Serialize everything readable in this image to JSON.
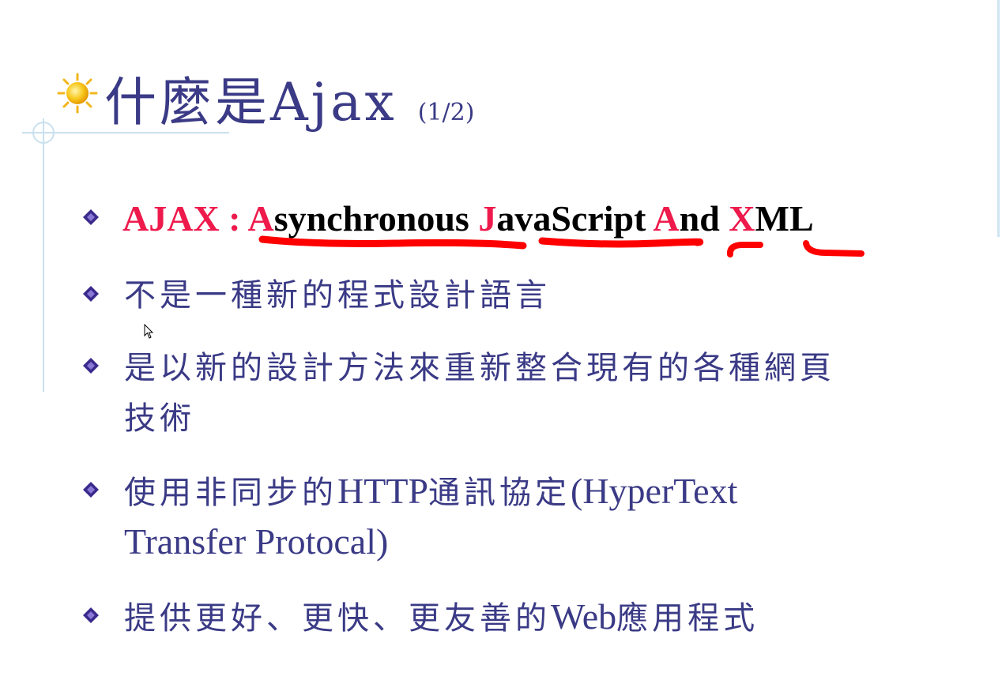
{
  "title": {
    "main": "什麼是Ajax",
    "page": "(1/2)"
  },
  "ajax": {
    "prefix": "AJAX : ",
    "words": [
      {
        "initial": "A",
        "rest": "synchronous "
      },
      {
        "initial": "J",
        "rest": "avaScript "
      },
      {
        "initial": "A",
        "rest": "nd "
      },
      {
        "initial": "X",
        "rest": "ML"
      }
    ]
  },
  "bullets": [
    {
      "line1": "不是一種新的程式設計語言"
    },
    {
      "line1": "是以新的設計方法來重新整合現有的各種網頁",
      "line2": "技術"
    },
    {
      "line1_cjk": "使用非同步的",
      "line1_latin": "HTTP",
      "line1_cjk2": "通訊協定",
      "line1_latin2": "(HyperText",
      "line2": "Transfer Protocal)"
    },
    {
      "line1_cjk": "提供更好、更快、更友善的",
      "line1_latin": "Web",
      "line1_cjk2": "應用程式"
    }
  ],
  "colors": {
    "text": "#3a3a86",
    "accent": "#ee1a4c",
    "bullet": "#3a2a8c",
    "underline": "#ff0000"
  },
  "icons": {
    "title": "sun-icon",
    "bullet": "diamond-bullet-icon",
    "pointer": "mouse-cursor-icon"
  }
}
